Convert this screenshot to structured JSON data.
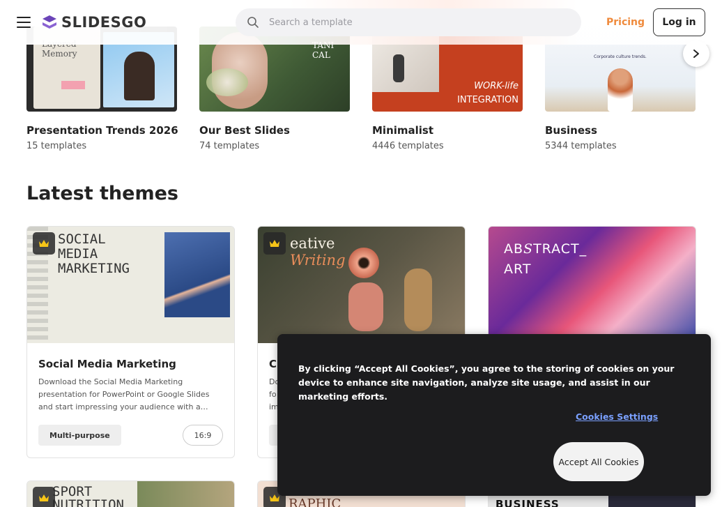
{
  "header": {
    "brand": "SLIDESGO",
    "search_placeholder": "Search a template",
    "pricing_label": "Pricing",
    "login_label": "Log in",
    "colors": {
      "accent": "#ef8a3c",
      "logo": "#6b44b8"
    }
  },
  "categories": [
    {
      "title": "Presentation Trends 2026",
      "count": "15 templates",
      "thumb_text_1": "Layered",
      "thumb_text_2": "Memory"
    },
    {
      "title": "Our Best Slides",
      "count": "74 templates",
      "thumb_text_1": "TANI",
      "thumb_text_2": "CAL"
    },
    {
      "title": "Minimalist",
      "count": "4446 templates",
      "thumb_text_1": "WORK-life",
      "thumb_text_2": "INTEGRATION"
    },
    {
      "title": "Business",
      "count": "5344 templates",
      "thumb_text_1": "Corporate culture trends."
    }
  ],
  "latest": {
    "section_title": "Latest themes",
    "cards": [
      {
        "title": "Social Media Marketing",
        "description": "Download the Social Media Marketing presentation for PowerPoint or Google Slides and start impressing your audience with a…",
        "tag": "Multi-purpose",
        "ratio": "16:9",
        "thumb_text": "SOCIAL\nMEDIA\nMARKETING"
      },
      {
        "title": "C",
        "description": "Do\nfo\nim",
        "thumb_text_1": "eative",
        "thumb_text_2": "Writing"
      },
      {
        "thumb_text_1": "AB",
        "thumb_text_2": "TRACT_",
        "thumb_text_3": "ART"
      }
    ],
    "second_row": [
      {
        "thumb_text": "SPORT\nNUTRITION"
      },
      {
        "thumb_text": "RAPHIC"
      },
      {
        "thumb_text": "BUSINESS"
      }
    ]
  },
  "cookie_banner": {
    "text": "By clicking “Accept All Cookies”, you agree to the storing of cookies on your device to enhance site navigation, analyze site usage, and assist in our marketing efforts.",
    "settings_label": "Cookies Settings",
    "accept_label": "Accept All Cookies"
  }
}
